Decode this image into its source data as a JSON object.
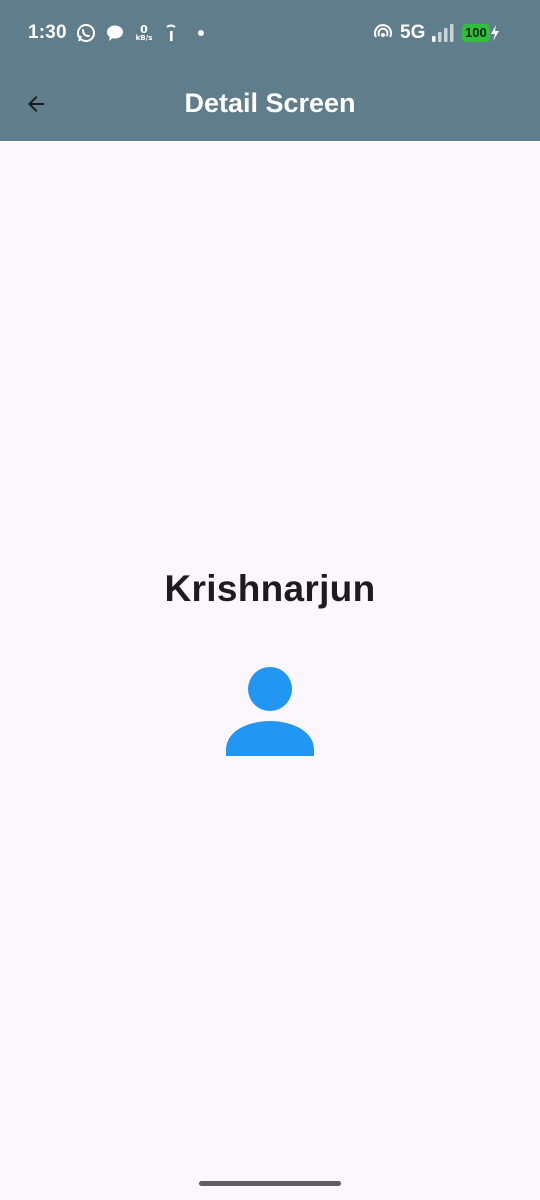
{
  "status_bar": {
    "time": "1:30",
    "network_speed_value": "0",
    "network_speed_unit": "kB/s",
    "network_type": "5G",
    "battery_level": "100",
    "icons": [
      "whatsapp-icon",
      "chat-bubble-icon",
      "network-speed-icon",
      "info-icon",
      "dot-icon",
      "hotspot-icon",
      "signal-icon",
      "battery-icon",
      "charging-icon"
    ]
  },
  "app_bar": {
    "title": "Detail Screen",
    "back_icon": "arrow-back-icon",
    "background_color": "#607d8b"
  },
  "content": {
    "name": "Krishnarjun",
    "avatar_icon": "person-icon",
    "accent_color": "#2196f3"
  },
  "colors": {
    "page_background": "#fcf6fd",
    "text_primary": "#1d1b20",
    "battery_green": "#2fbf3d"
  }
}
